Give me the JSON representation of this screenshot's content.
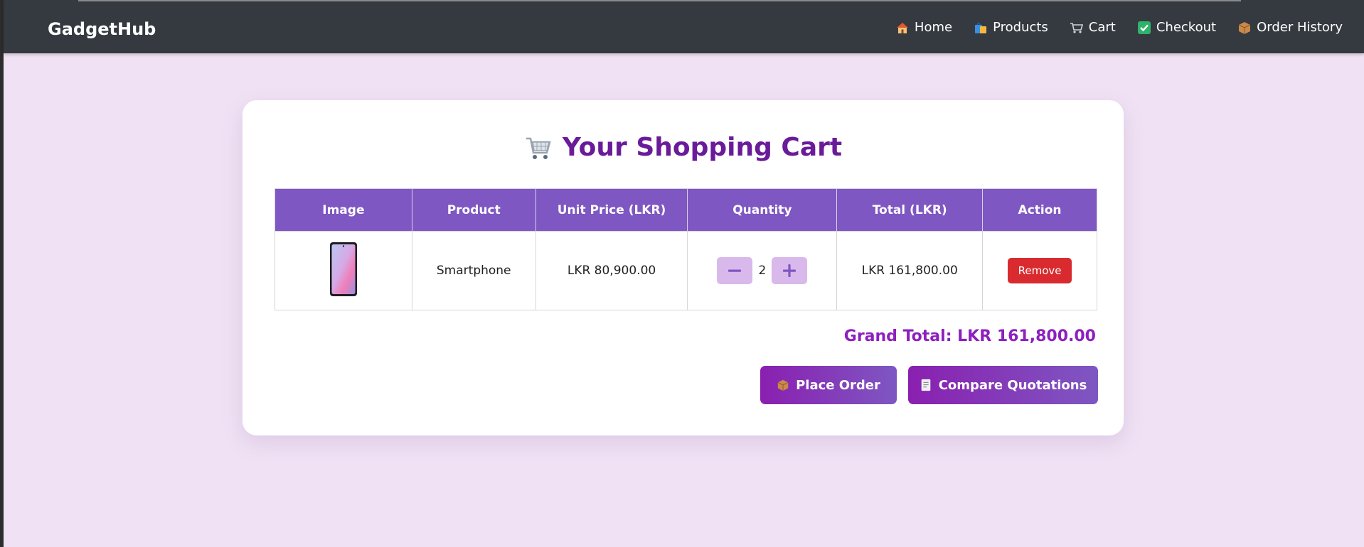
{
  "navbar": {
    "brand": "GadgetHub",
    "links": [
      {
        "label": "Home",
        "icon": "home-icon"
      },
      {
        "label": "Products",
        "icon": "shopping-bags-icon"
      },
      {
        "label": "Cart",
        "icon": "cart-icon"
      },
      {
        "label": "Checkout",
        "icon": "check-icon"
      },
      {
        "label": "Order History",
        "icon": "package-icon"
      }
    ]
  },
  "cart": {
    "title": "Your Shopping Cart",
    "columns": [
      "Image",
      "Product",
      "Unit Price (LKR)",
      "Quantity",
      "Total (LKR)",
      "Action"
    ],
    "items": [
      {
        "product": "Smartphone",
        "unit_price": "LKR 80,900.00",
        "quantity": "2",
        "total": "LKR 161,800.00",
        "action": "Remove"
      }
    ],
    "grand_total": "Grand Total: LKR 161,800.00",
    "place_order": "Place Order",
    "compare_quotations": "Compare Quotations"
  },
  "colors": {
    "navbar_bg": "#343a40",
    "page_bg": "#f0e2f4",
    "header_bg": "#7e57c2",
    "title": "#6a1b9a",
    "remove": "#d92b2f",
    "grand_total": "#8e1fbf"
  }
}
